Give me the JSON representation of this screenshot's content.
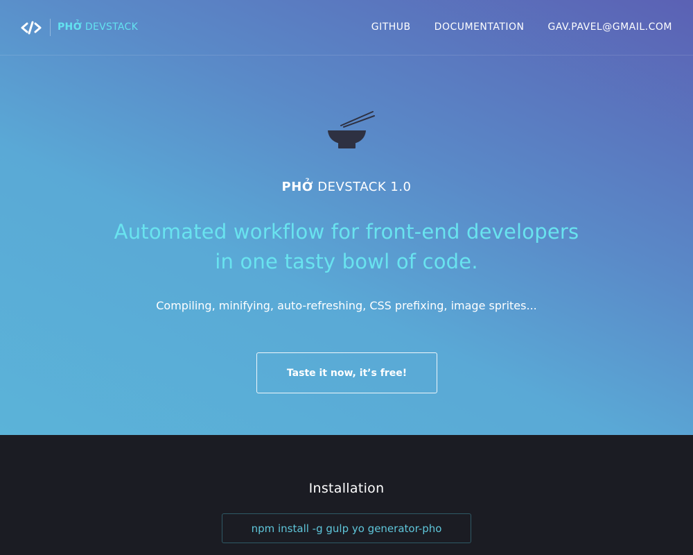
{
  "header": {
    "brand_bold": "PHỞ",
    "brand_rest": " DEVSTACK",
    "logo_icon": "code-brackets-icon",
    "nav": [
      {
        "label": "GITHUB"
      },
      {
        "label": "DOCUMENTATION"
      },
      {
        "label": "GAV.PAVEL@GMAIL.COM"
      }
    ]
  },
  "hero": {
    "icon": "bowl-chopsticks-icon",
    "product_bold": "PHỞ",
    "product_rest": " DEVSTACK 1.0",
    "headline": "Automated workflow for front-end developers in one tasty bowl of code.",
    "subline": "Compiling, minifying, auto-refreshing, CSS prefixing, image sprites...",
    "cta_label": "Taste it now, it’s free!"
  },
  "installation": {
    "title": "Installation",
    "command": "npm install -g gulp yo generator-pho"
  },
  "colors": {
    "accent": "#63e2f0",
    "dark_bg": "#1b1c23",
    "gradient_start": "#5bb3d8",
    "gradient_end": "#5b61b4"
  }
}
